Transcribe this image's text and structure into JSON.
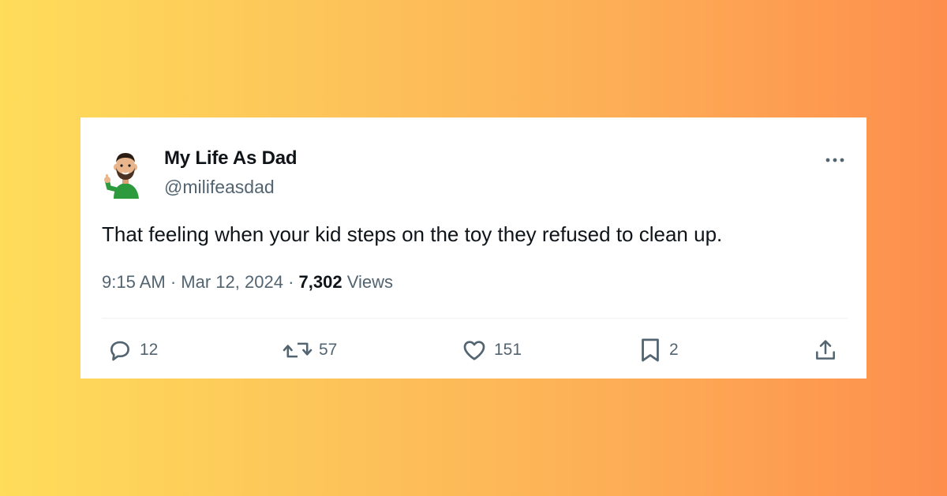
{
  "tweet": {
    "display_name": "My Life As Dad",
    "handle": "@milifeasdad",
    "text": "That feeling when your kid steps on the toy they refused to clean up.",
    "time": "9:15 AM",
    "separator": "·",
    "date": "Mar 12, 2024",
    "views_count": "7,302",
    "views_label": "Views",
    "actions": {
      "replies": "12",
      "retweets": "57",
      "likes": "151",
      "bookmarks": "2"
    }
  },
  "icons": {
    "avatar": "bitmoji-avatar",
    "more": "more-horizontal-icon",
    "reply": "reply-icon",
    "retweet": "retweet-icon",
    "like": "heart-icon",
    "bookmark": "bookmark-icon",
    "share": "share-icon"
  },
  "colors": {
    "background_start": "#fedd5a",
    "background_end": "#fd8e4d",
    "card": "#ffffff",
    "primary_text": "#0f1419",
    "secondary_text": "#536471",
    "avatar_shirt": "#2e9a3e"
  }
}
